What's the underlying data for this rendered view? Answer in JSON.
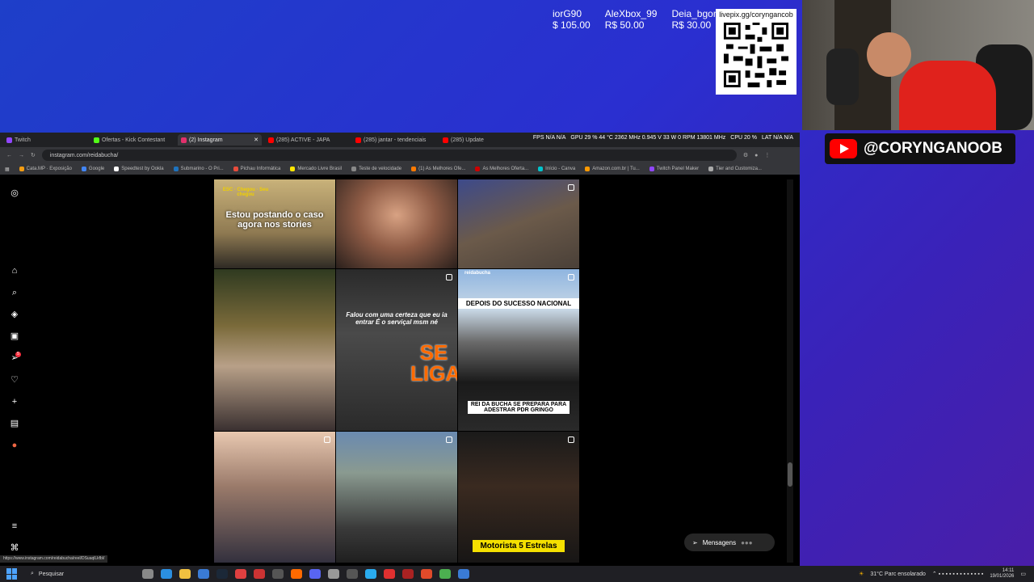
{
  "overlay": {
    "donations": [
      {
        "name": "iorG90",
        "amount": "$ 105.00"
      },
      {
        "name": "AleXbox_99",
        "amount": "R$ 50.00"
      },
      {
        "name": "Deia_bgon",
        "amount": "R$ 30.00"
      }
    ],
    "qr_label": "livepix.gg/coryngancob",
    "youtube_handle": "@CORYNGANOOB"
  },
  "browser": {
    "tabs": [
      {
        "label": "Twitch",
        "color": "#9146ff",
        "active": false
      },
      {
        "label": "Ofertas - Kick Contestant",
        "color": "#53fc18",
        "active": false
      },
      {
        "label": "(2) Instagram",
        "color": "#e1306c",
        "active": true
      },
      {
        "label": "(285) ACTIVE - JAPA",
        "color": "#ff0000",
        "active": false
      },
      {
        "label": "(285) jantar - tendenciais",
        "color": "#ff0000",
        "active": false
      },
      {
        "label": "(285) Update",
        "color": "#ff0000",
        "active": false
      }
    ],
    "perf": {
      "fps": "FPS N/A N/A",
      "gpu": "GPU 29 % 44 °C 2362 MHz 0.945 V 33 W 0 RPM 13801 MHz",
      "cpu": "CPU 20 %",
      "lat": "LAT N/A N/A"
    },
    "url": "instagram.com/reidabucha/",
    "bookmarks": [
      {
        "label": "Cata.MP · Exposição",
        "color": "#f39c12"
      },
      {
        "label": "Google",
        "color": "#4285f4"
      },
      {
        "label": "Speedtest by Ookla",
        "color": "#ffffff"
      },
      {
        "label": "Submarino - O Pri...",
        "color": "#1e73be"
      },
      {
        "label": "Pichau Informática",
        "color": "#e74c3c"
      },
      {
        "label": "Mercado Livre Brasil",
        "color": "#ffe600"
      },
      {
        "label": "Teste de velocidade",
        "color": "#888888"
      },
      {
        "label": "(1) As Melhores Ofe...",
        "color": "#ff7a00"
      },
      {
        "label": "As Melhores Oferta...",
        "color": "#cc0000"
      },
      {
        "label": "Início - Canva",
        "color": "#00c4cc"
      },
      {
        "label": "Amazon.com.br | Tu...",
        "color": "#ff9900"
      },
      {
        "label": "Twitch Panel Maker",
        "color": "#9146ff"
      },
      {
        "label": "Tier and Customiza...",
        "color": "#aaaaaa"
      }
    ],
    "status_url": "https://www.instagram.com/reidabucha/reel/DSuaqlLkfbl/"
  },
  "instagram": {
    "nav_icons": [
      "instagram-logo-icon",
      "home-icon",
      "search-icon",
      "explore-icon",
      "reels-icon",
      "messages-icon",
      "notifications-icon",
      "create-icon",
      "dashboard-icon",
      "profile-icon",
      "menu-icon",
      "also-from-meta-icon"
    ],
    "messages_badge": "5",
    "posts": [
      {
        "caption": "Estou postando o caso agora nos stories",
        "tags": "ESC · Chegou · Seu chegou"
      },
      {
        "caption": ""
      },
      {
        "caption": ""
      },
      {
        "caption": ""
      },
      {
        "caption": "Falou com uma certeza que eu ia entrar É o serviçal msm né",
        "overlay": "SE LIGA"
      },
      {
        "caption": "DEPOIS DO SUCESSO NACIONAL",
        "caption2": "REI DA BUCHA SE PREPARA PARA ADESTRAR PDR GRINGO",
        "user": "reidabucha"
      },
      {
        "caption": ""
      },
      {
        "caption": ""
      },
      {
        "caption": "Motorista 5 Estrelas"
      }
    ],
    "messages_button": "Mensagens"
  },
  "taskbar": {
    "search_placeholder": "Pesquisar",
    "weather": "31°C Parc ensolarado",
    "time": "14:11",
    "date": "19/01/2026"
  }
}
